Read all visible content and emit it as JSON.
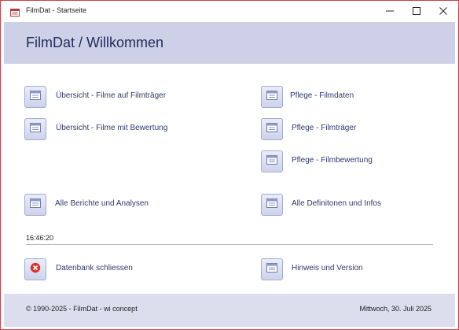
{
  "window": {
    "title": "FilmDat - Startseite",
    "icons": {
      "app": "access-form-icon",
      "minimize": "minimize-icon",
      "maximize": "maximize-icon",
      "close": "close-icon"
    }
  },
  "header": {
    "title": "FilmDat / Willkommen"
  },
  "entries": {
    "overview_carrier": {
      "label": "Übersicht - Filme auf Filmträger",
      "icon": "form-icon"
    },
    "overview_rating": {
      "label": "Übersicht - Filme mit Bewertung",
      "icon": "form-icon"
    },
    "maint_filmdata": {
      "label": "Pflege - Filmdaten",
      "icon": "form-icon"
    },
    "maint_carrier": {
      "label": "Pflege - Filmträger",
      "icon": "form-icon"
    },
    "maint_rating": {
      "label": "Pflege - Filmbewertung",
      "icon": "form-icon"
    },
    "all_reports": {
      "label": "Alle Berichte und Analysen",
      "icon": "form-icon"
    },
    "all_definitions": {
      "label": "Alle Definitonen und Infos",
      "icon": "form-icon"
    },
    "close_db": {
      "label": "Datenbank schliessen",
      "icon": "close-circle-icon"
    },
    "about": {
      "label": "Hinweis und Version",
      "icon": "form-icon"
    }
  },
  "status": {
    "time": "16:46:20"
  },
  "footer": {
    "copyright": "© 1990-2025 - FilmDat - wi concept",
    "date": "Mittwoch, 30. Juli 2025"
  },
  "colors": {
    "window_border": "#c8434b",
    "header_band": "#cdd0e6",
    "footer_band": "#dcdeee",
    "label_text": "#2e3a6a",
    "title_text": "#1e2b5a",
    "close_button_red": "#d9342b"
  }
}
